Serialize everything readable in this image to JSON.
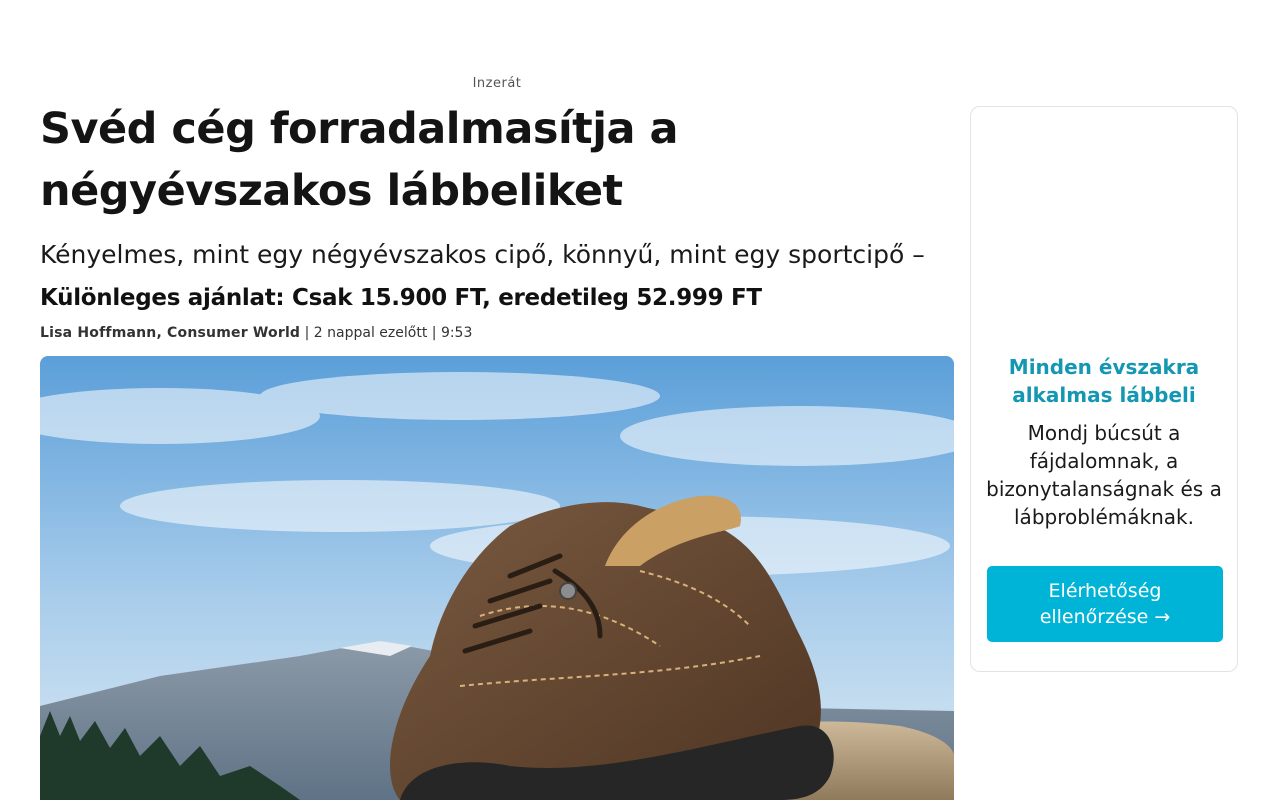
{
  "ad_label": "Inzerát",
  "article": {
    "headline": "Svéd cég forradalmasítja a négyévszakos lábbeliket",
    "subheadline": "Kényelmes, mint egy négyévszakos cipő, könnyű, mint egy sportcipő –",
    "offer": "Különleges ajánlat: Csak 15.900 FT, eredetileg 52.999 FT",
    "byline": {
      "author": "Lisa Hoffmann, Consumer World",
      "separator_1": " | ",
      "date": "2 nappal ezelőtt",
      "separator_2": " | ",
      "time": "9:53"
    },
    "hero_image": "brown-leather-hiking-shoe-on-rock-mountain-landscape"
  },
  "sidebar": {
    "title": "Minden évszakra alkalmas lábbeli",
    "text": "Mondj búcsút a fájdalomnak, a bizonytalanságnak és a lábproblémáknak.",
    "cta_label": "Elérhetőség ellenőrzése →"
  },
  "colors": {
    "accent": "#00b4d8",
    "title_accent": "#1497b2",
    "text": "#1a1a1a"
  }
}
